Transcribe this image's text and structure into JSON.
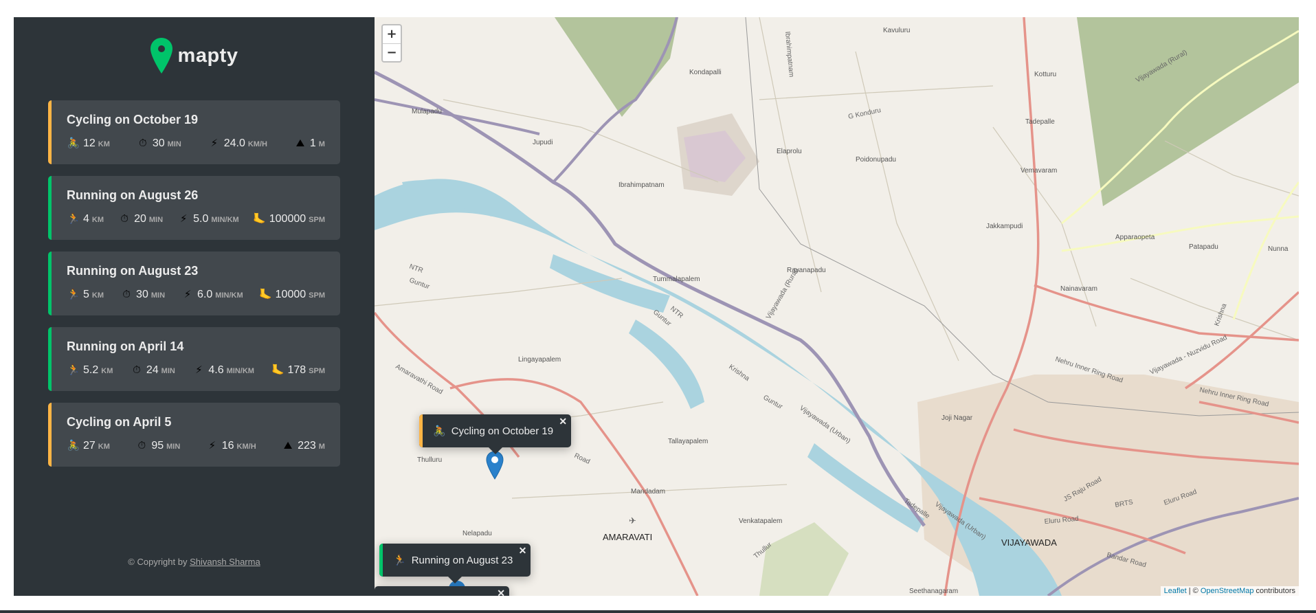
{
  "brand": {
    "name": "mapty"
  },
  "colors": {
    "running": "#00c46a",
    "cycling": "#ffb545",
    "sidebar": "#2d3439",
    "card": "#42484d",
    "water": "#aad3df"
  },
  "workouts": [
    {
      "type": "cycling",
      "title": "Cycling on October 19",
      "details": [
        {
          "icon": "bicycle-icon",
          "glyph": "🚴",
          "value": "12",
          "unit": "km"
        },
        {
          "icon": "stopwatch-icon",
          "glyph": "⏱",
          "value": "30",
          "unit": "min"
        },
        {
          "icon": "lightning-icon",
          "glyph": "⚡",
          "value": "24.0",
          "unit": "km/h"
        },
        {
          "icon": "mountain-icon",
          "glyph": "⛰",
          "value": "1",
          "unit": "m"
        }
      ]
    },
    {
      "type": "running",
      "title": "Running on August 26",
      "details": [
        {
          "icon": "runner-icon",
          "glyph": "🏃",
          "value": "4",
          "unit": "km"
        },
        {
          "icon": "stopwatch-icon",
          "glyph": "⏱",
          "value": "20",
          "unit": "min"
        },
        {
          "icon": "lightning-icon",
          "glyph": "⚡",
          "value": "5.0",
          "unit": "min/km"
        },
        {
          "icon": "footprint-icon",
          "glyph": "🦶",
          "value": "100000",
          "unit": "spm"
        }
      ]
    },
    {
      "type": "running",
      "title": "Running on August 23",
      "details": [
        {
          "icon": "runner-icon",
          "glyph": "🏃",
          "value": "5",
          "unit": "km"
        },
        {
          "icon": "stopwatch-icon",
          "glyph": "⏱",
          "value": "30",
          "unit": "min"
        },
        {
          "icon": "lightning-icon",
          "glyph": "⚡",
          "value": "6.0",
          "unit": "min/km"
        },
        {
          "icon": "footprint-icon",
          "glyph": "🦶",
          "value": "10000",
          "unit": "spm"
        }
      ]
    },
    {
      "type": "running",
      "title": "Running on April 14",
      "details": [
        {
          "icon": "runner-icon",
          "glyph": "🏃",
          "value": "5.2",
          "unit": "km"
        },
        {
          "icon": "stopwatch-icon",
          "glyph": "⏱",
          "value": "24",
          "unit": "min"
        },
        {
          "icon": "lightning-icon",
          "glyph": "⚡",
          "value": "4.6",
          "unit": "min/km"
        },
        {
          "icon": "footprint-icon",
          "glyph": "🦶",
          "value": "178",
          "unit": "spm"
        }
      ]
    },
    {
      "type": "cycling",
      "title": "Cycling on April 5",
      "details": [
        {
          "icon": "bicycle-icon",
          "glyph": "🚴",
          "value": "27",
          "unit": "km"
        },
        {
          "icon": "stopwatch-icon",
          "glyph": "⏱",
          "value": "95",
          "unit": "min"
        },
        {
          "icon": "lightning-icon",
          "glyph": "⚡",
          "value": "16",
          "unit": "km/h"
        },
        {
          "icon": "mountain-icon",
          "glyph": "⛰",
          "value": "223",
          "unit": "m"
        }
      ]
    }
  ],
  "footer": {
    "prefix": "© Copyright by ",
    "author": "Shivansh Sharma"
  },
  "map": {
    "zoom_in": "+",
    "zoom_out": "−",
    "popups": [
      {
        "type": "cycling",
        "glyph": "🚴",
        "text": "Cycling on October 19",
        "close": "✕"
      },
      {
        "type": "running",
        "glyph": "🏃",
        "text": "Running on August 23",
        "close": "✕"
      },
      {
        "close": "✕"
      }
    ],
    "attribution": {
      "leaflet": "Leaflet",
      "sep": " | © ",
      "osm": "OpenStreetMap",
      "suffix": " contributors"
    },
    "labels": {
      "kavuluru": "Kavuluru",
      "kondapalli": "Kondapalli",
      "mulapadu": "Mulapadu",
      "jupudi": "Jupudi",
      "ibrahimpatnam": "Ibrahimpatnam",
      "ibrahimpatnam_rd": "Ibrahimpatnam",
      "elaprolu": "Elaprolu",
      "g_konduru": "G Konduru",
      "poidonupadu": "Poidonupadu",
      "kotturu": "Kotturu",
      "tadepalle_n": "Tadepalle",
      "vemavaram": "Vemavaram",
      "jakkampudi": "Jakkampudi",
      "apparaopeta": "Apparaopeta",
      "patapadu": "Patapadu",
      "nainavaram": "Nainavaram",
      "rayanapadu": "Rayanapadu",
      "tummalapalem": "Tummalapalem",
      "lingayapalem": "Lingayapalem",
      "tallayapalem": "Tallayapalem",
      "mandadam": "Mandadam",
      "amaravati": "AMARAVATI",
      "nelapadu": "Nelapadu",
      "venkatapalem": "Venkatapalem",
      "vijayawada": "VIJAYAWADA",
      "jojinagar": "Joji Nagar",
      "seethanagaram": "Seethanagaram",
      "thulluru": "Thulluru",
      "thullur": "Thullur",
      "amaravathi_rd": "Amaravathi Road",
      "nehru_ring": "Nehru Inner Ring Road",
      "nehru_ring2": "Nehru Inner Ring Road",
      "eluru_rd": "Eluru Road",
      "eluru_rd2": "Eluru Road",
      "bandar_rd": "Bandar Road",
      "brts": "BRTS",
      "js_raju": "JS Raju Road",
      "vij_rural": "Vijayawada (Rural)",
      "vij_rural2": "Vijayawada (Rural)",
      "vij_urban": "Vijayawada (Urban)",
      "vij_urban2": "Vijayawada (Urban)",
      "krishna": "Krishna",
      "krishna2": "Krishna",
      "ntr": "NTR",
      "ntr2": "NTR",
      "guntur": "Guntur",
      "guntur2": "Guntur",
      "guntur3": "Guntur",
      "tadepalle_s": "Tadepalle",
      "nunna": "Nunna",
      "nuzvidu": "Vijayawada - Nuzvidu Road",
      "road": "Road"
    }
  }
}
